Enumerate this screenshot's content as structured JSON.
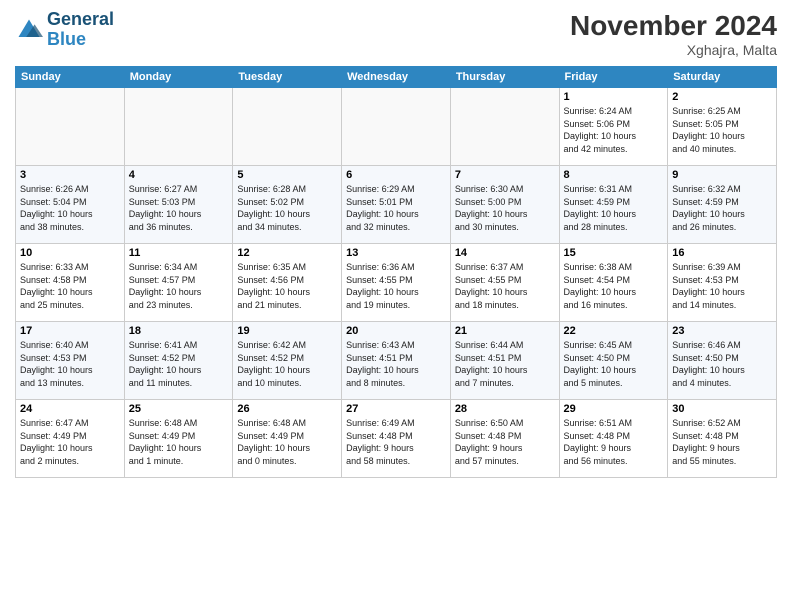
{
  "header": {
    "logo_line1": "General",
    "logo_line2": "Blue",
    "title": "November 2024",
    "location": "Xghajra, Malta"
  },
  "weekdays": [
    "Sunday",
    "Monday",
    "Tuesday",
    "Wednesday",
    "Thursday",
    "Friday",
    "Saturday"
  ],
  "weeks": [
    [
      {
        "day": "",
        "info": ""
      },
      {
        "day": "",
        "info": ""
      },
      {
        "day": "",
        "info": ""
      },
      {
        "day": "",
        "info": ""
      },
      {
        "day": "",
        "info": ""
      },
      {
        "day": "1",
        "info": "Sunrise: 6:24 AM\nSunset: 5:06 PM\nDaylight: 10 hours\nand 42 minutes."
      },
      {
        "day": "2",
        "info": "Sunrise: 6:25 AM\nSunset: 5:05 PM\nDaylight: 10 hours\nand 40 minutes."
      }
    ],
    [
      {
        "day": "3",
        "info": "Sunrise: 6:26 AM\nSunset: 5:04 PM\nDaylight: 10 hours\nand 38 minutes."
      },
      {
        "day": "4",
        "info": "Sunrise: 6:27 AM\nSunset: 5:03 PM\nDaylight: 10 hours\nand 36 minutes."
      },
      {
        "day": "5",
        "info": "Sunrise: 6:28 AM\nSunset: 5:02 PM\nDaylight: 10 hours\nand 34 minutes."
      },
      {
        "day": "6",
        "info": "Sunrise: 6:29 AM\nSunset: 5:01 PM\nDaylight: 10 hours\nand 32 minutes."
      },
      {
        "day": "7",
        "info": "Sunrise: 6:30 AM\nSunset: 5:00 PM\nDaylight: 10 hours\nand 30 minutes."
      },
      {
        "day": "8",
        "info": "Sunrise: 6:31 AM\nSunset: 4:59 PM\nDaylight: 10 hours\nand 28 minutes."
      },
      {
        "day": "9",
        "info": "Sunrise: 6:32 AM\nSunset: 4:59 PM\nDaylight: 10 hours\nand 26 minutes."
      }
    ],
    [
      {
        "day": "10",
        "info": "Sunrise: 6:33 AM\nSunset: 4:58 PM\nDaylight: 10 hours\nand 25 minutes."
      },
      {
        "day": "11",
        "info": "Sunrise: 6:34 AM\nSunset: 4:57 PM\nDaylight: 10 hours\nand 23 minutes."
      },
      {
        "day": "12",
        "info": "Sunrise: 6:35 AM\nSunset: 4:56 PM\nDaylight: 10 hours\nand 21 minutes."
      },
      {
        "day": "13",
        "info": "Sunrise: 6:36 AM\nSunset: 4:55 PM\nDaylight: 10 hours\nand 19 minutes."
      },
      {
        "day": "14",
        "info": "Sunrise: 6:37 AM\nSunset: 4:55 PM\nDaylight: 10 hours\nand 18 minutes."
      },
      {
        "day": "15",
        "info": "Sunrise: 6:38 AM\nSunset: 4:54 PM\nDaylight: 10 hours\nand 16 minutes."
      },
      {
        "day": "16",
        "info": "Sunrise: 6:39 AM\nSunset: 4:53 PM\nDaylight: 10 hours\nand 14 minutes."
      }
    ],
    [
      {
        "day": "17",
        "info": "Sunrise: 6:40 AM\nSunset: 4:53 PM\nDaylight: 10 hours\nand 13 minutes."
      },
      {
        "day": "18",
        "info": "Sunrise: 6:41 AM\nSunset: 4:52 PM\nDaylight: 10 hours\nand 11 minutes."
      },
      {
        "day": "19",
        "info": "Sunrise: 6:42 AM\nSunset: 4:52 PM\nDaylight: 10 hours\nand 10 minutes."
      },
      {
        "day": "20",
        "info": "Sunrise: 6:43 AM\nSunset: 4:51 PM\nDaylight: 10 hours\nand 8 minutes."
      },
      {
        "day": "21",
        "info": "Sunrise: 6:44 AM\nSunset: 4:51 PM\nDaylight: 10 hours\nand 7 minutes."
      },
      {
        "day": "22",
        "info": "Sunrise: 6:45 AM\nSunset: 4:50 PM\nDaylight: 10 hours\nand 5 minutes."
      },
      {
        "day": "23",
        "info": "Sunrise: 6:46 AM\nSunset: 4:50 PM\nDaylight: 10 hours\nand 4 minutes."
      }
    ],
    [
      {
        "day": "24",
        "info": "Sunrise: 6:47 AM\nSunset: 4:49 PM\nDaylight: 10 hours\nand 2 minutes."
      },
      {
        "day": "25",
        "info": "Sunrise: 6:48 AM\nSunset: 4:49 PM\nDaylight: 10 hours\nand 1 minute."
      },
      {
        "day": "26",
        "info": "Sunrise: 6:48 AM\nSunset: 4:49 PM\nDaylight: 10 hours\nand 0 minutes."
      },
      {
        "day": "27",
        "info": "Sunrise: 6:49 AM\nSunset: 4:48 PM\nDaylight: 9 hours\nand 58 minutes."
      },
      {
        "day": "28",
        "info": "Sunrise: 6:50 AM\nSunset: 4:48 PM\nDaylight: 9 hours\nand 57 minutes."
      },
      {
        "day": "29",
        "info": "Sunrise: 6:51 AM\nSunset: 4:48 PM\nDaylight: 9 hours\nand 56 minutes."
      },
      {
        "day": "30",
        "info": "Sunrise: 6:52 AM\nSunset: 4:48 PM\nDaylight: 9 hours\nand 55 minutes."
      }
    ]
  ]
}
